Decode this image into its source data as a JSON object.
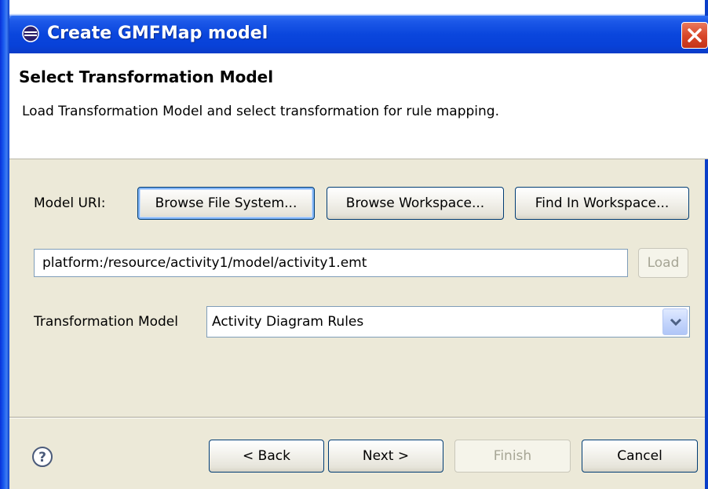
{
  "window": {
    "title": "Create GMFMap model",
    "title_icon": "eclipse-icon",
    "close_icon": "close-icon"
  },
  "header": {
    "title": "Select Transformation Model",
    "description": "Load Transformation Model and select transformation for rule mapping."
  },
  "model_uri": {
    "label": "Model URI:",
    "browse_file_system": "Browse File System...",
    "browse_workspace": "Browse Workspace...",
    "find_in_workspace": "Find In Workspace...",
    "value": "platform:/resource/activity1/model/activity1.emt",
    "load": "Load"
  },
  "transformation": {
    "label": "Transformation Model",
    "selected": "Activity Diagram Rules"
  },
  "footer": {
    "help_icon": "help-icon",
    "back": "< Back",
    "next": "Next >",
    "finish": "Finish",
    "cancel": "Cancel"
  },
  "colors": {
    "title_bar": "#0a46dd",
    "dialog_bg": "#ece9d8",
    "close_button": "#d9482a"
  }
}
